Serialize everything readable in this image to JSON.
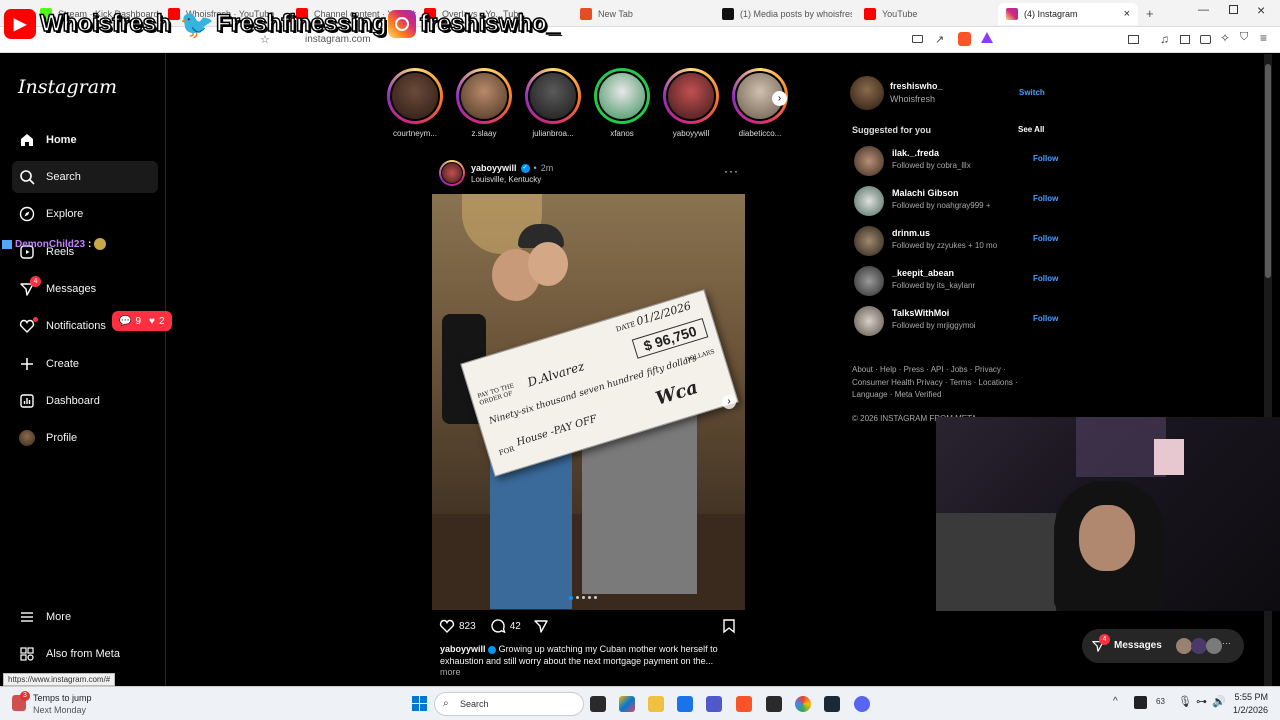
{
  "browser": {
    "tabs": [
      {
        "label": "Stream · Kick Dashboard",
        "color": "#53fc18"
      },
      {
        "label": "Whoisfresh · YouTube",
        "color": "#ff0000"
      },
      {
        "label": "Channel content · YouTube",
        "color": "#ff0000"
      },
      {
        "label": "Overlays · Yo...Tube",
        "color": "#ff0000"
      },
      {
        "label": "New Tab",
        "color": "#e44d26"
      },
      {
        "label": "(1) Media posts by whoisfresh",
        "color": "#111111"
      },
      {
        "label": "YouTube",
        "color": "#ff0000"
      },
      {
        "label": "(4) Instagram",
        "color": "#d62976"
      }
    ],
    "url": "instagram.com"
  },
  "stream_overlay": {
    "youtube": "Whoisfresh",
    "twitter": "Freshfinessing",
    "instagram": "freshiswho_",
    "chat_user": "DemonChild23",
    "chat_sep": ":",
    "notif_comments": "9",
    "notif_likes": "2"
  },
  "sidebar": {
    "logo": "Instagram",
    "items": [
      {
        "label": "Home",
        "icon": "home-icon"
      },
      {
        "label": "Search",
        "icon": "search-icon"
      },
      {
        "label": "Explore",
        "icon": "compass-icon"
      },
      {
        "label": "Reels",
        "icon": "reels-icon"
      },
      {
        "label": "Messages",
        "icon": "messenger-icon",
        "badge": "4"
      },
      {
        "label": "Notifications",
        "icon": "heart-icon"
      },
      {
        "label": "Create",
        "icon": "plus-icon"
      },
      {
        "label": "Dashboard",
        "icon": "dashboard-icon"
      },
      {
        "label": "Profile",
        "icon": "avatar"
      }
    ],
    "more": "More",
    "meta": "Also from Meta"
  },
  "stories": [
    {
      "name": "courtneym...",
      "ring": "gradient"
    },
    {
      "name": "z.slaay",
      "ring": "gradient"
    },
    {
      "name": "julianbroa...",
      "ring": "gradient"
    },
    {
      "name": "xfanos",
      "ring": "green"
    },
    {
      "name": "yaboyywill",
      "ring": "gradient"
    },
    {
      "name": "diabeticco...",
      "ring": "gradient"
    }
  ],
  "post": {
    "username": "yaboyywill",
    "time": "2m",
    "dot": "•",
    "location": "Louisville, Kentucky",
    "likes": "823",
    "comments": "42",
    "caption": "Growing up watching my Cuban mother work herself to exhaustion and still worry about the next mortgage payment on the...",
    "more": "more",
    "check": {
      "date_label": "DATE",
      "date": "01/2/2026",
      "amount": "$ 96,750",
      "pay_to_label": "PAY TO THE ORDER OF",
      "payee": "D.Alvarez",
      "written_amount": "Ninety-six thousand seven hundred fifty dollars",
      "dollars_label": "DOLLARS",
      "for_label": "FOR",
      "memo": "House -PAY OFF",
      "signature": "Wca"
    }
  },
  "right": {
    "account_user": "freshiswho_",
    "account_name": "Whoisfresh",
    "switch": "Switch",
    "suggested": "Suggested for you",
    "see_all": "See All",
    "suggestions": [
      {
        "user": "ilak._.freda",
        "sub": "Followed by cobra_lllx",
        "follow": "Follow"
      },
      {
        "user": "Malachi Gibson",
        "sub": "Followed by noahgray999 +",
        "follow": "Follow"
      },
      {
        "user": "drinm.us",
        "sub": "Followed by zzyukes + 10 mo",
        "follow": "Follow"
      },
      {
        "user": "_keepit_abean",
        "sub": "Followed by its_kaylanr",
        "follow": "Follow"
      },
      {
        "user": "TalksWithMoi",
        "sub": "Followed by mrjiggymoi",
        "follow": "Follow"
      }
    ],
    "footer1": "About · Help · Press · API · Jobs · Privacy ·",
    "footer2": "Consumer Health Privacy · Terms · Locations ·",
    "footer3": "Language · Meta Verified",
    "copyright": "© 2026 INSTAGRAM FROM META"
  },
  "messages_pill": {
    "label": "Messages",
    "badge": "4",
    "more": "···"
  },
  "status_url": "https://www.instagram.com/#",
  "taskbar": {
    "weather_temp": "Temps to jump",
    "weather_sub": "Next Monday",
    "weather_badge": "3",
    "search": "Search",
    "time": "5:55 PM",
    "date": "1/2/2026",
    "tray_num": "63"
  }
}
